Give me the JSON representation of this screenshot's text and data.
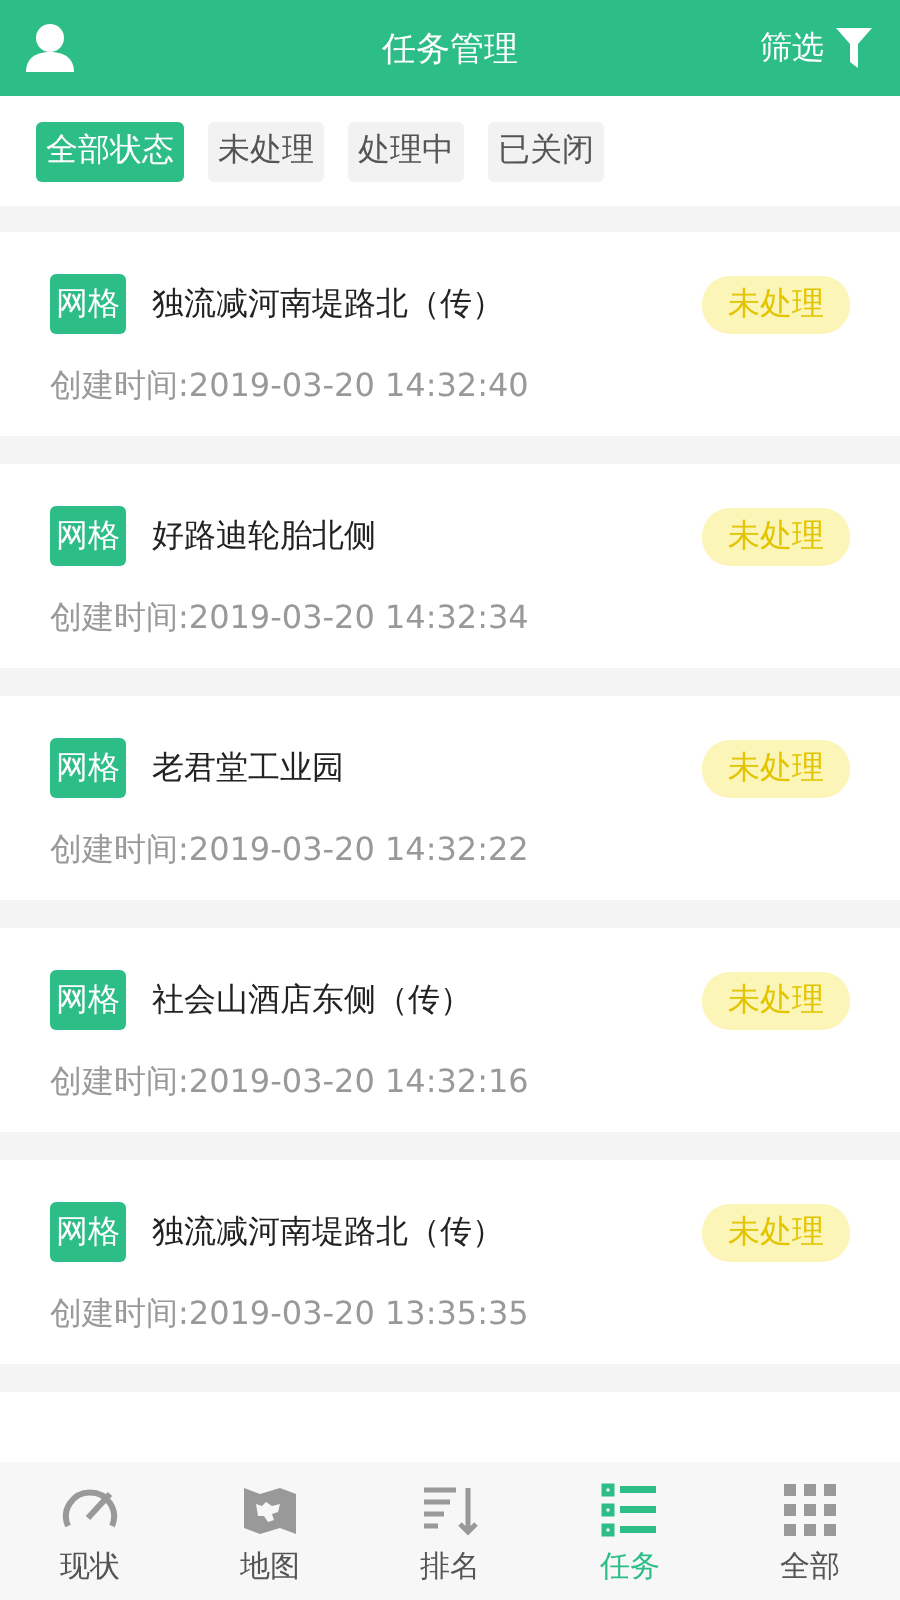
{
  "header": {
    "title": "任务管理",
    "filter_label": "筛选"
  },
  "status_filters": [
    {
      "label": "全部状态",
      "selected": true
    },
    {
      "label": "未处理",
      "selected": false
    },
    {
      "label": "处理中",
      "selected": false
    },
    {
      "label": "已关闭",
      "selected": false
    }
  ],
  "tasks": [
    {
      "tag": "网格",
      "title": "独流减河南堤路北（传）",
      "created": "创建时间:2019-03-20 14:32:40",
      "status": "未处理"
    },
    {
      "tag": "网格",
      "title": "好路迪轮胎北侧",
      "created": "创建时间:2019-03-20 14:32:34",
      "status": "未处理"
    },
    {
      "tag": "网格",
      "title": "老君堂工业园",
      "created": "创建时间:2019-03-20 14:32:22",
      "status": "未处理"
    },
    {
      "tag": "网格",
      "title": "社会山酒店东侧（传）",
      "created": "创建时间:2019-03-20 14:32:16",
      "status": "未处理"
    },
    {
      "tag": "网格",
      "title": "独流减河南堤路北（传）",
      "created": "创建时间:2019-03-20 13:35:35",
      "status": "未处理"
    }
  ],
  "tab_bar": [
    {
      "kind": "gauge",
      "label": "现状",
      "selected": false
    },
    {
      "kind": "map",
      "label": "地图",
      "selected": false
    },
    {
      "kind": "rank",
      "label": "排名",
      "selected": false
    },
    {
      "kind": "tasks",
      "label": "任务",
      "selected": true
    },
    {
      "kind": "all",
      "label": "全部",
      "selected": false
    }
  ]
}
